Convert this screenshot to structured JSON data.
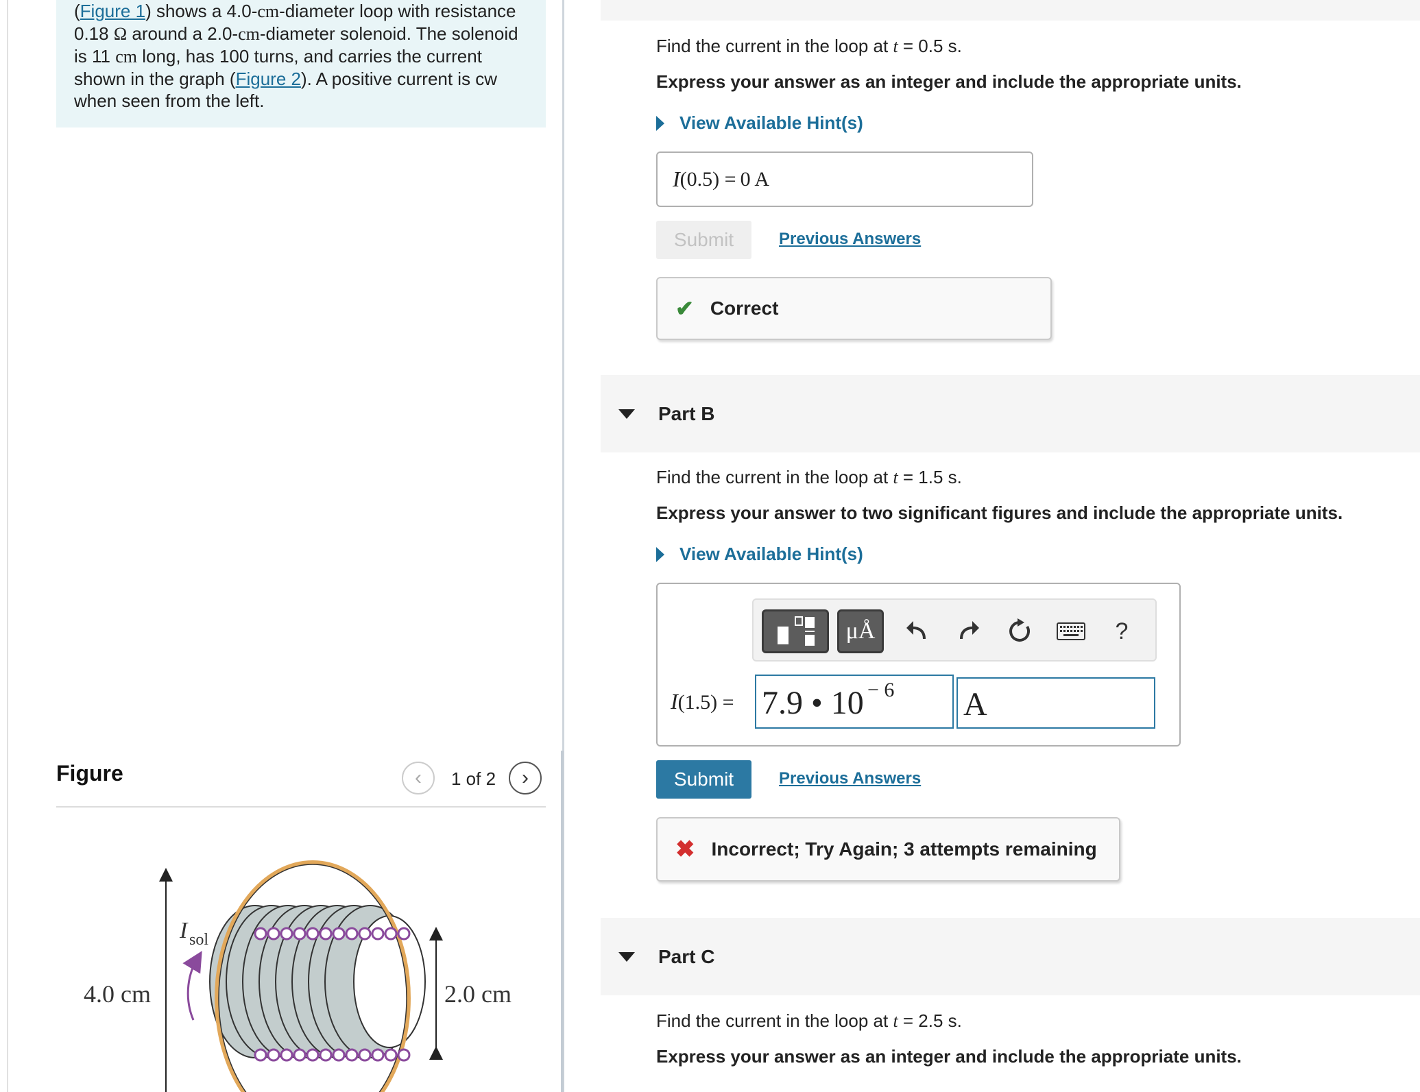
{
  "problem": {
    "link1": "Figure 1",
    "line1": ") shows a 4.0-",
    "cm1": "cm",
    "line1b": "-diameter loop with resistance",
    "resistance": "0.18",
    "ohm": "Ω",
    "line2": " around a 2.0-",
    "cm2": "cm",
    "line2b": "-diameter solenoid. The solenoid",
    "line3a": "is 11 ",
    "cm3": "cm",
    "line3b": " long, has 100 turns, and carries the current",
    "line4a": "shown in the graph (",
    "link2": "Figure 2",
    "line4b": "). A positive current is cw",
    "line5": "when seen from the left."
  },
  "figure": {
    "title": "Figure",
    "counter": "1 of 2",
    "prev": "‹",
    "next": "›",
    "label_loop": "4.0 cm",
    "label_solenoid": "2.0 cm",
    "label_current": "I",
    "label_current_sub": "sol"
  },
  "partA": {
    "question_pre": "Find the current in the loop at ",
    "t": "t",
    "question_post": " = 0.5 s.",
    "instruction": "Express your answer as an integer and include the appropriate units.",
    "hint": "View Available Hint(s)",
    "answer_label": "I",
    "answer_arg": "(0.5) = ",
    "answer_value": "0 A",
    "submit": "Submit",
    "previous": "Previous Answers",
    "feedback": "Correct",
    "feedback_icon": "✔"
  },
  "partB": {
    "title": "Part B",
    "question_pre": "Find the current in the loop at ",
    "t": "t",
    "question_post": " = 1.5 s.",
    "instruction": "Express your answer to two significant figures and include the appropriate units.",
    "hint": "View Available Hint(s)",
    "answer_label": "I",
    "answer_arg": "(1.5) = ",
    "value_mantissa": "7.9 • 10",
    "value_exponent": "− 6",
    "unit": "A",
    "toolbar": {
      "units_button": "μÅ",
      "help": "?"
    },
    "submit": "Submit",
    "previous": "Previous Answers",
    "feedback": "Incorrect; Try Again; 3 attempts remaining",
    "feedback_icon": "✖"
  },
  "partC": {
    "title": "Part C",
    "question_pre": "Find the current in the loop at ",
    "t": "t",
    "question_post": " = 2.5 s.",
    "instruction": "Express your answer as an integer and include the appropriate units."
  },
  "colors": {
    "accent": "#1c6e99",
    "submit": "#2c79a3",
    "correct": "#3a8a3a",
    "incorrect": "#d32f2f",
    "problem_bg": "#e9f5f7"
  }
}
